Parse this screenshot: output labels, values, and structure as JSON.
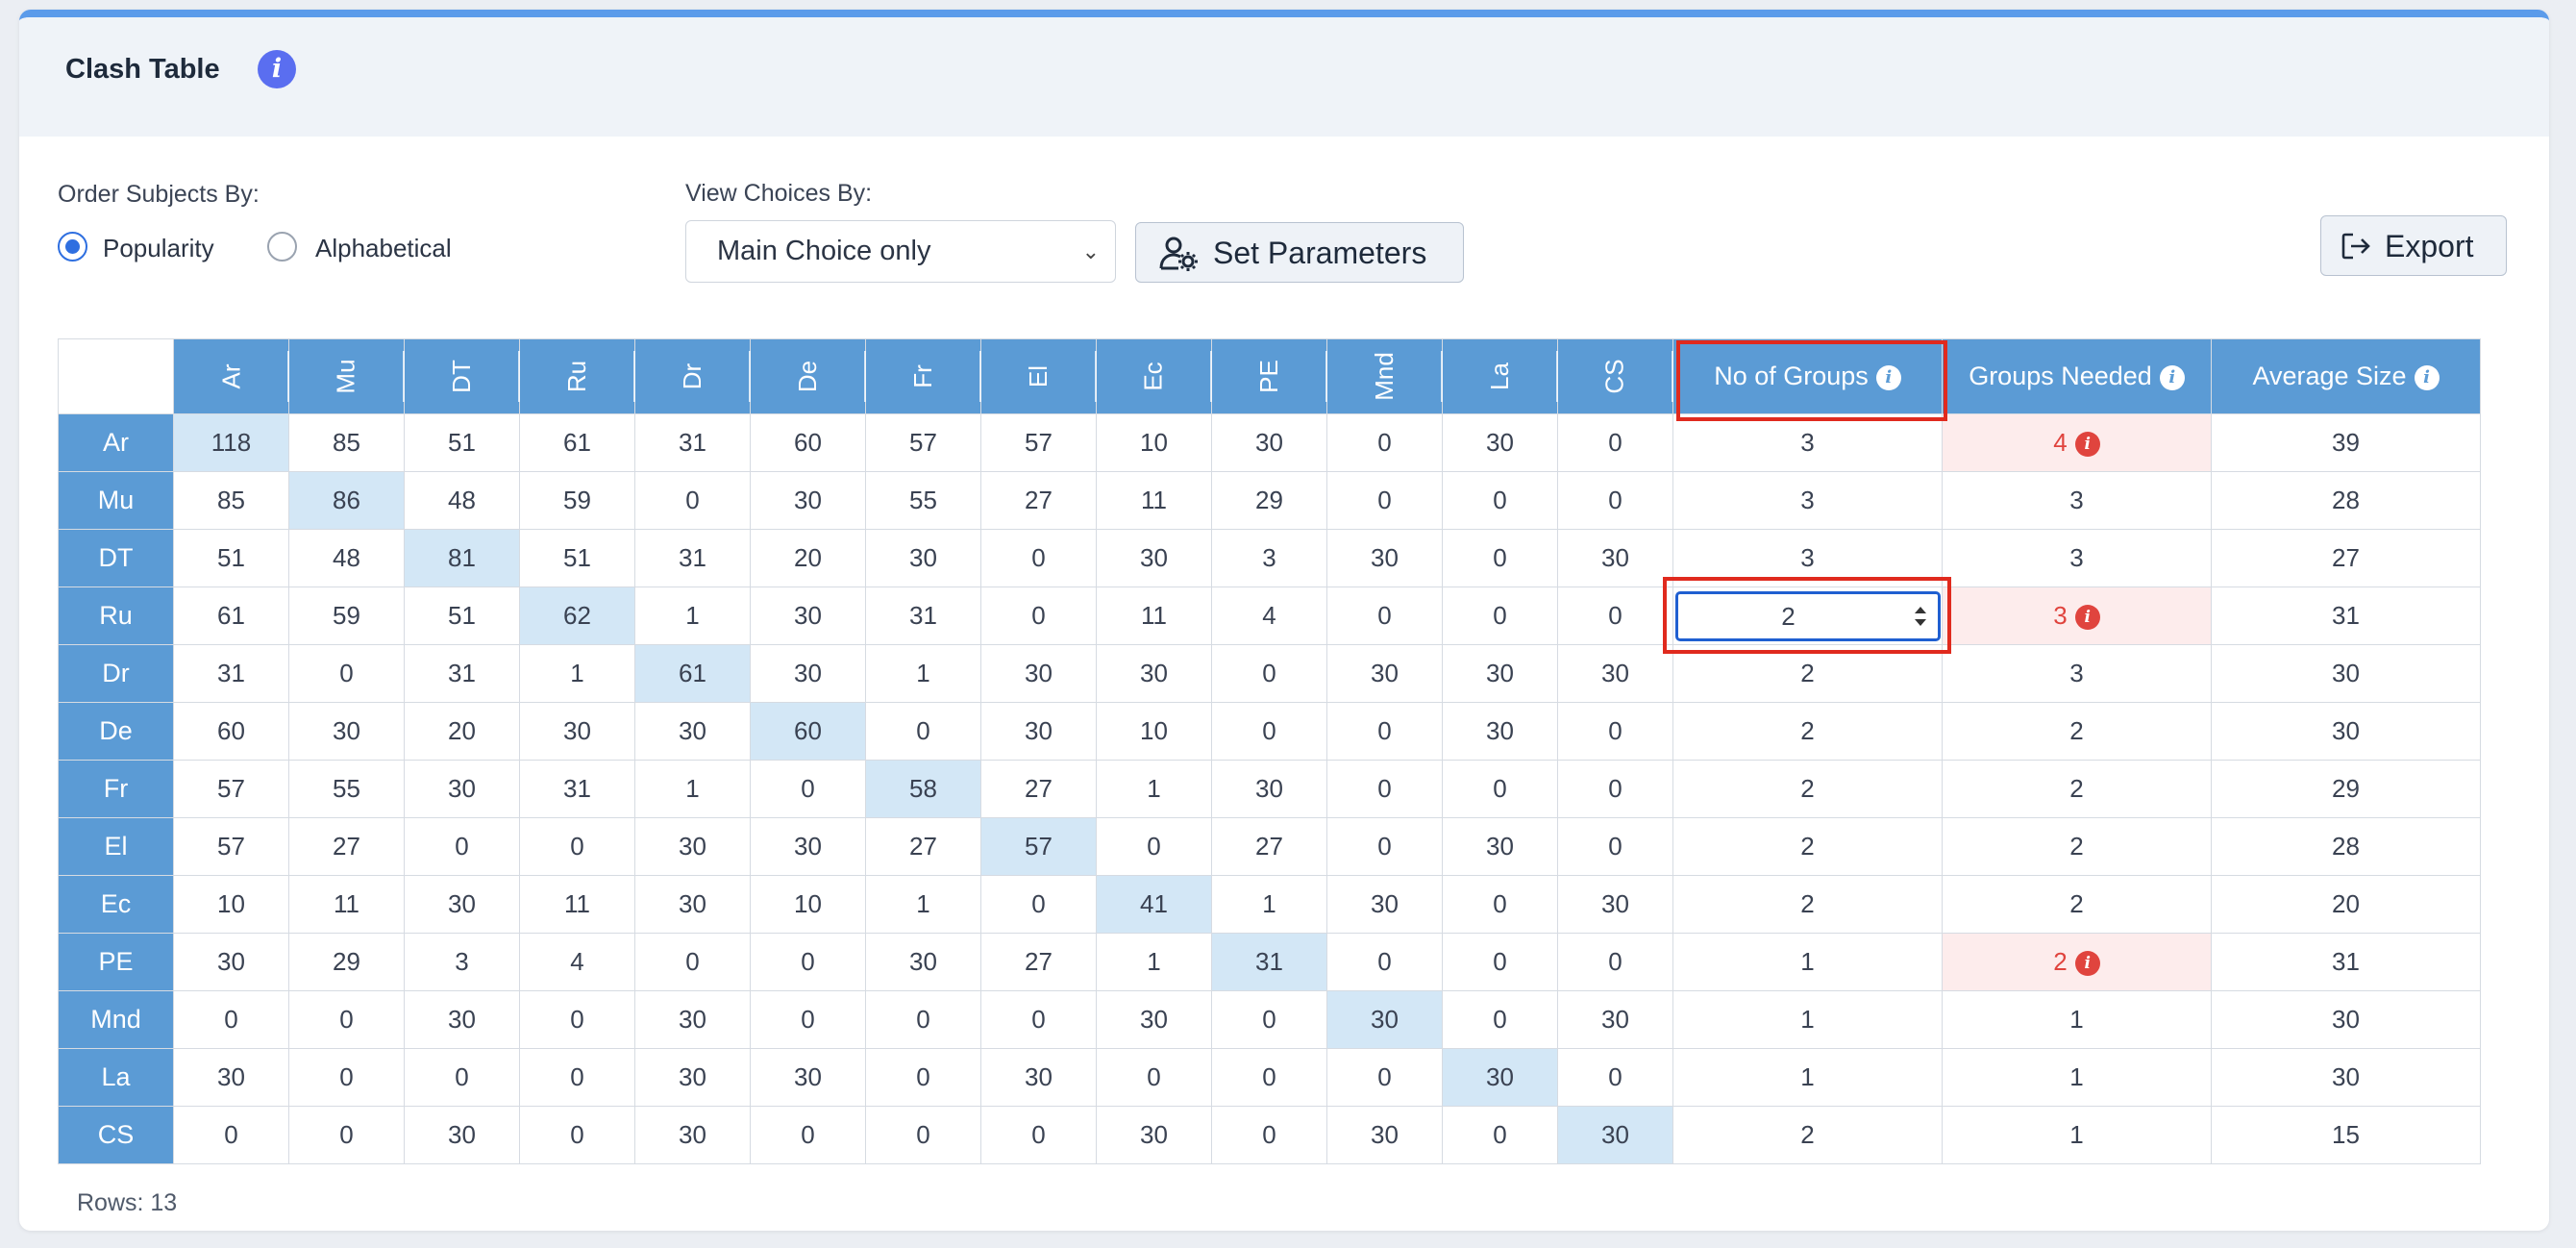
{
  "header": {
    "title": "Clash Table",
    "info_glyph": "i"
  },
  "order_by": {
    "label": "Order Subjects By:",
    "options": [
      {
        "label": "Popularity",
        "selected": true
      },
      {
        "label": "Alphabetical",
        "selected": false
      }
    ]
  },
  "view_by": {
    "label": "View Choices By:",
    "selected": "Main Choice only"
  },
  "buttons": {
    "set_parameters": "Set Parameters",
    "export": "Export"
  },
  "table": {
    "subjects": [
      "Ar",
      "Mu",
      "DT",
      "Ru",
      "Dr",
      "De",
      "Fr",
      "El",
      "Ec",
      "PE",
      "Mnd",
      "La",
      "CS"
    ],
    "summary_headers": {
      "groups": "No of Groups",
      "needed": "Groups Needed",
      "avg": "Average Size"
    },
    "rows": [
      {
        "label": "Ar",
        "cells": [
          "118",
          "85",
          "51",
          "61",
          "31",
          "60",
          "57",
          "57",
          "10",
          "30",
          "0",
          "30",
          "0"
        ],
        "groups": "3",
        "needed": "4",
        "needed_warn": true,
        "avg": "39"
      },
      {
        "label": "Mu",
        "cells": [
          "85",
          "86",
          "48",
          "59",
          "0",
          "30",
          "55",
          "27",
          "11",
          "29",
          "0",
          "0",
          "0"
        ],
        "groups": "3",
        "needed": "3",
        "needed_warn": false,
        "avg": "28"
      },
      {
        "label": "DT",
        "cells": [
          "51",
          "48",
          "81",
          "51",
          "31",
          "20",
          "30",
          "0",
          "30",
          "3",
          "30",
          "0",
          "30"
        ],
        "groups": "3",
        "needed": "3",
        "needed_warn": false,
        "avg": "27"
      },
      {
        "label": "Ru",
        "cells": [
          "61",
          "59",
          "51",
          "62",
          "1",
          "30",
          "31",
          "0",
          "11",
          "4",
          "0",
          "0",
          "0"
        ],
        "groups": "2",
        "needed": "3",
        "needed_warn": true,
        "avg": "31",
        "editing": true
      },
      {
        "label": "Dr",
        "cells": [
          "31",
          "0",
          "31",
          "1",
          "61",
          "30",
          "1",
          "30",
          "30",
          "0",
          "30",
          "30",
          "30"
        ],
        "groups": "2",
        "needed": "3",
        "needed_warn": false,
        "avg": "30"
      },
      {
        "label": "De",
        "cells": [
          "60",
          "30",
          "20",
          "30",
          "30",
          "60",
          "0",
          "30",
          "10",
          "0",
          "0",
          "30",
          "0"
        ],
        "groups": "2",
        "needed": "2",
        "needed_warn": false,
        "avg": "30"
      },
      {
        "label": "Fr",
        "cells": [
          "57",
          "55",
          "30",
          "31",
          "1",
          "0",
          "58",
          "27",
          "1",
          "30",
          "0",
          "0",
          "0"
        ],
        "groups": "2",
        "needed": "2",
        "needed_warn": false,
        "avg": "29"
      },
      {
        "label": "El",
        "cells": [
          "57",
          "27",
          "0",
          "0",
          "30",
          "30",
          "27",
          "57",
          "0",
          "27",
          "0",
          "30",
          "0"
        ],
        "groups": "2",
        "needed": "2",
        "needed_warn": false,
        "avg": "28"
      },
      {
        "label": "Ec",
        "cells": [
          "10",
          "11",
          "30",
          "11",
          "30",
          "10",
          "1",
          "0",
          "41",
          "1",
          "30",
          "0",
          "30"
        ],
        "groups": "2",
        "needed": "2",
        "needed_warn": false,
        "avg": "20"
      },
      {
        "label": "PE",
        "cells": [
          "30",
          "29",
          "3",
          "4",
          "0",
          "0",
          "30",
          "27",
          "1",
          "31",
          "0",
          "0",
          "0"
        ],
        "groups": "1",
        "needed": "2",
        "needed_warn": true,
        "avg": "31"
      },
      {
        "label": "Mnd",
        "cells": [
          "0",
          "0",
          "30",
          "0",
          "30",
          "0",
          "0",
          "0",
          "30",
          "0",
          "30",
          "0",
          "30"
        ],
        "groups": "1",
        "needed": "1",
        "needed_warn": false,
        "avg": "30"
      },
      {
        "label": "La",
        "cells": [
          "30",
          "0",
          "0",
          "0",
          "30",
          "30",
          "0",
          "30",
          "0",
          "0",
          "0",
          "30",
          "0"
        ],
        "groups": "1",
        "needed": "1",
        "needed_warn": false,
        "avg": "30"
      },
      {
        "label": "CS",
        "cells": [
          "0",
          "0",
          "30",
          "0",
          "30",
          "0",
          "0",
          "0",
          "30",
          "0",
          "30",
          "0",
          "30"
        ],
        "groups": "2",
        "needed": "1",
        "needed_warn": false,
        "avg": "15"
      }
    ]
  },
  "footer": {
    "rows_label": "Rows: 13"
  },
  "colors": {
    "accent": "#5b9bd5",
    "diagonal": "#d3e7f6",
    "warning": "#e0443e",
    "highlight": "#e02a1e"
  }
}
